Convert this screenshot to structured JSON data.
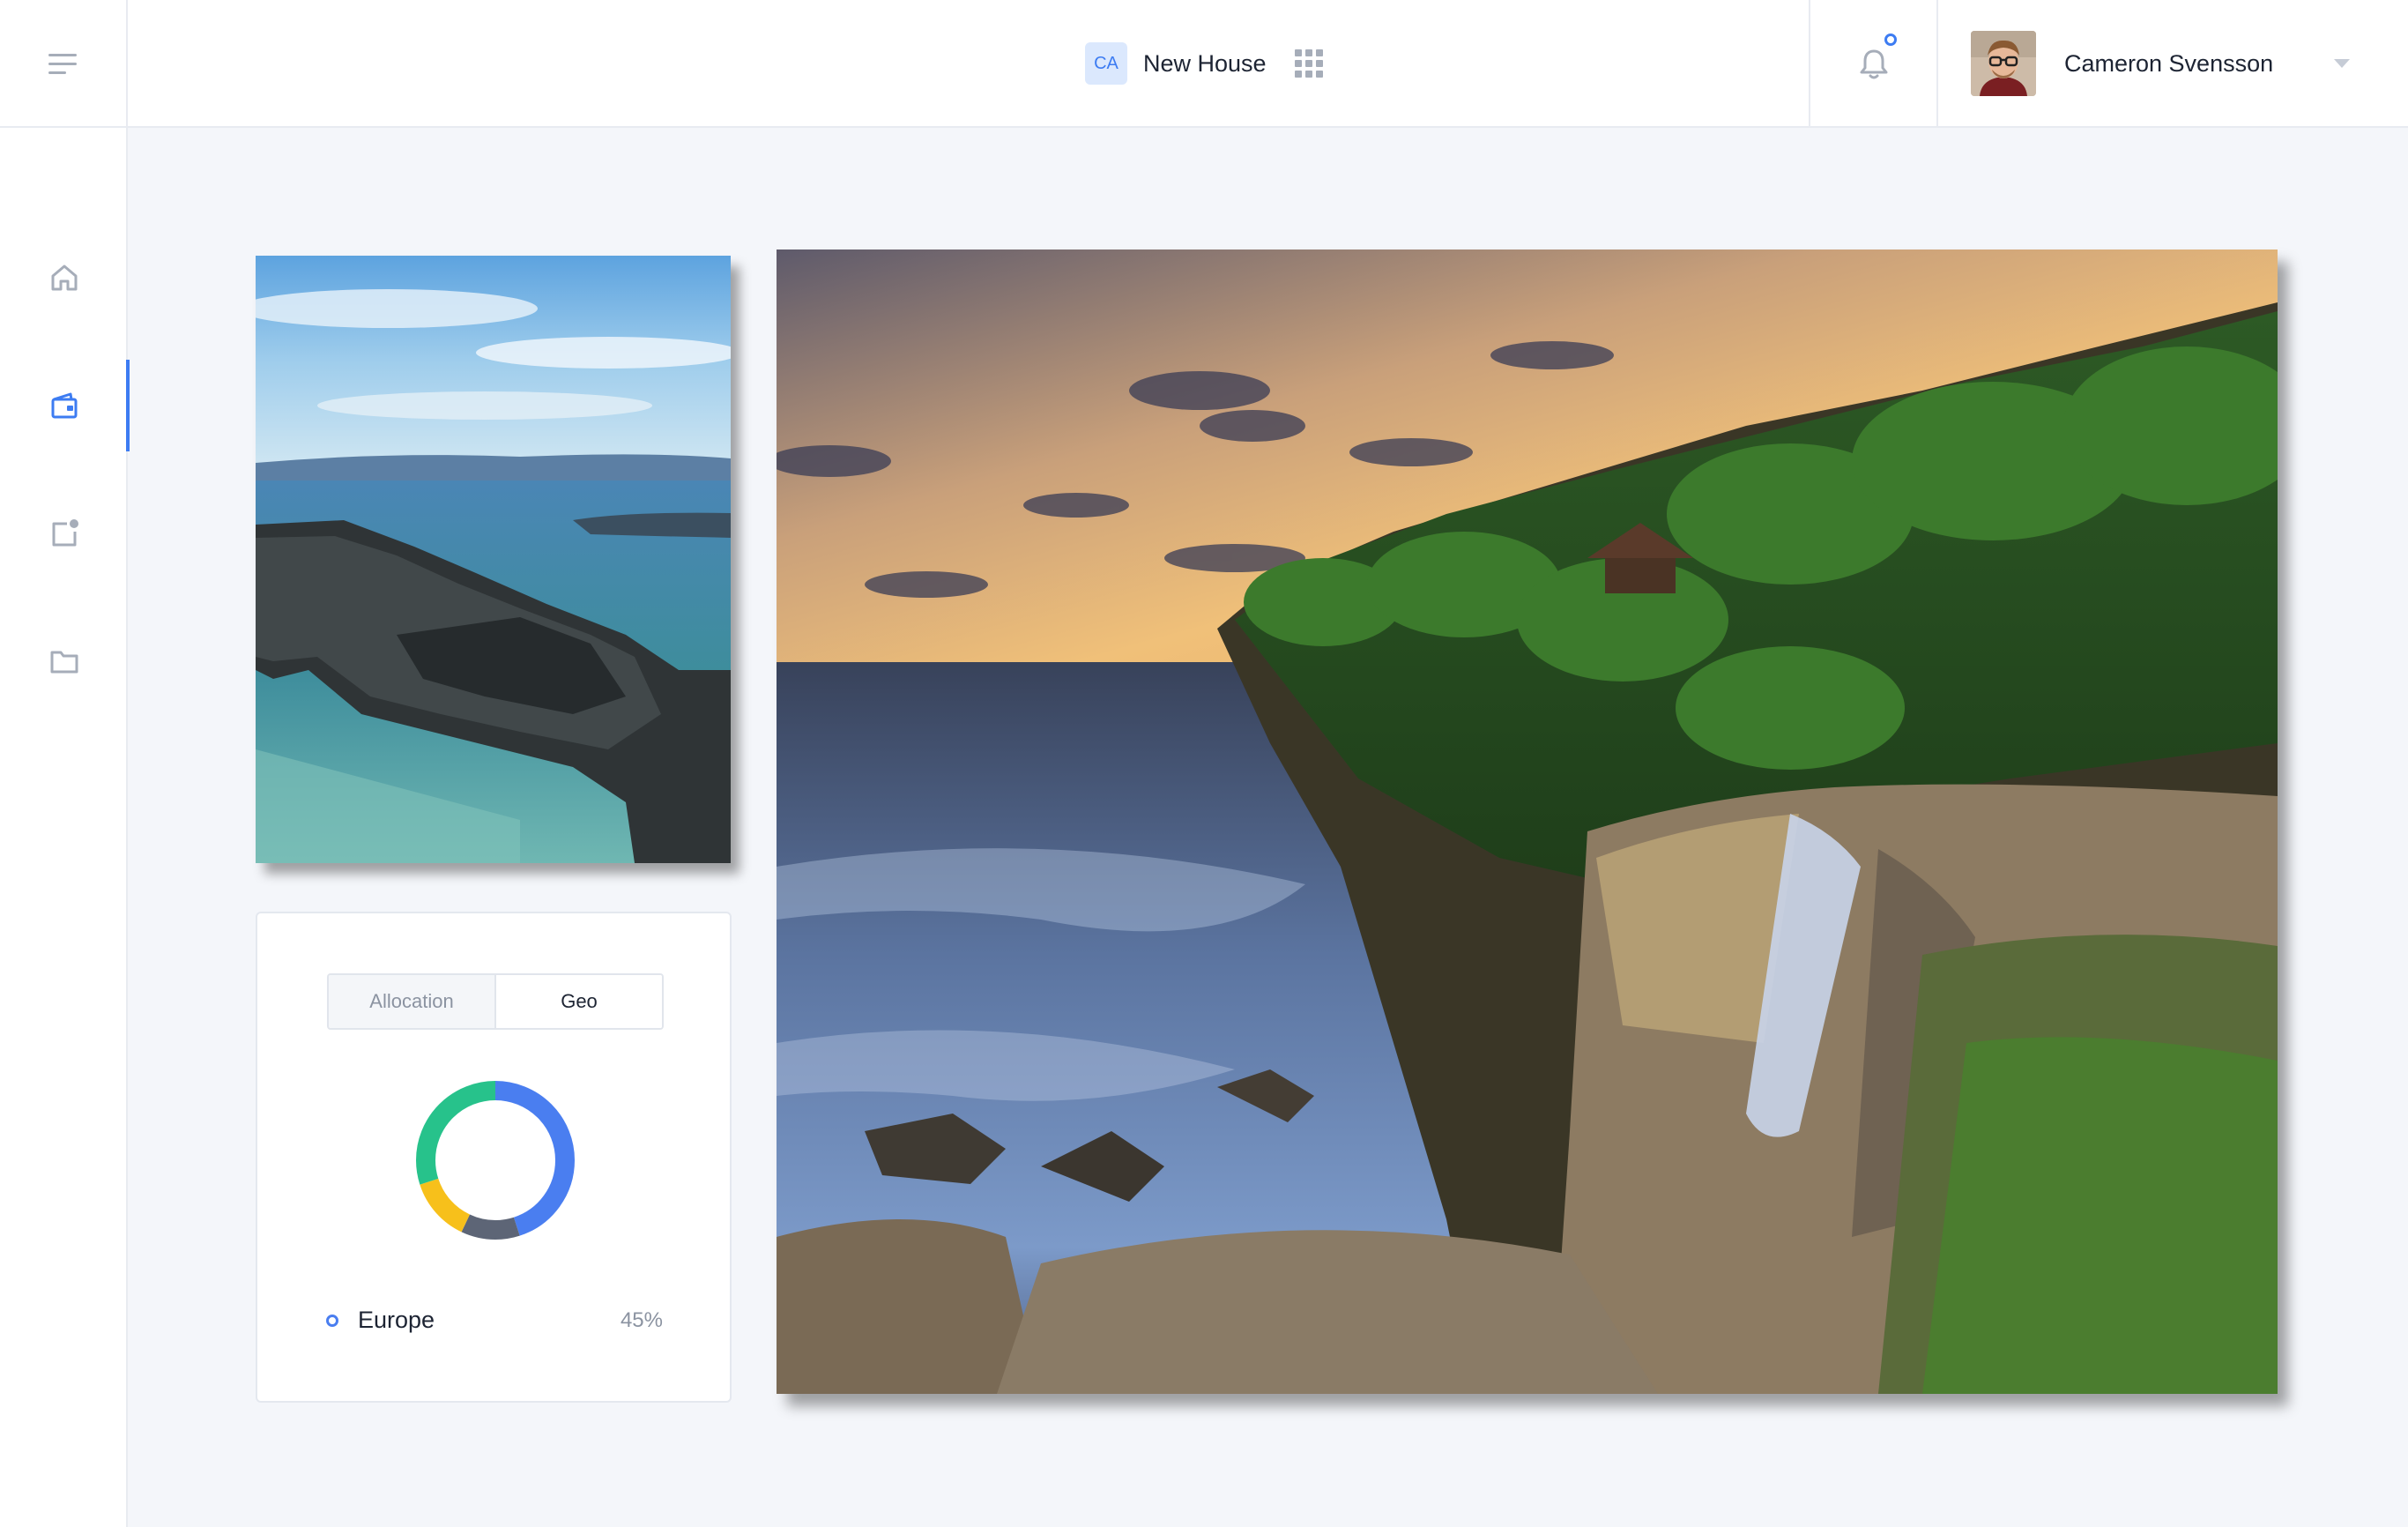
{
  "header": {
    "workspace": {
      "badge": "CA",
      "name": "New House"
    },
    "notification_badge": true,
    "user": {
      "name": "Cameron Svensson"
    }
  },
  "sidebar": {
    "items": [
      {
        "icon": "home-icon",
        "active": false
      },
      {
        "icon": "wallet-icon",
        "active": true
      },
      {
        "icon": "notification-square-icon",
        "active": false
      },
      {
        "icon": "folder-icon",
        "active": false
      }
    ]
  },
  "images": {
    "small": "rocky-coastline-photo",
    "large": "coastal-waterfall-sunset-photo"
  },
  "allocation_card": {
    "tabs": [
      "Allocation",
      "Geo"
    ],
    "selected_tab": "Geo",
    "legend": {
      "label": "Europe",
      "value": "45%"
    }
  },
  "chart_data": {
    "type": "pie",
    "donut": true,
    "slices": [
      {
        "value": 45,
        "color": "#4a7ef0"
      },
      {
        "value": 12,
        "color": "#5d6576"
      },
      {
        "value": 13,
        "color": "#f7c01b"
      },
      {
        "value": 30,
        "color": "#27c28b"
      }
    ]
  },
  "colors": {
    "accent": "#3d7cf2",
    "background": "#f4f6fa",
    "border": "#e8ebf1"
  }
}
